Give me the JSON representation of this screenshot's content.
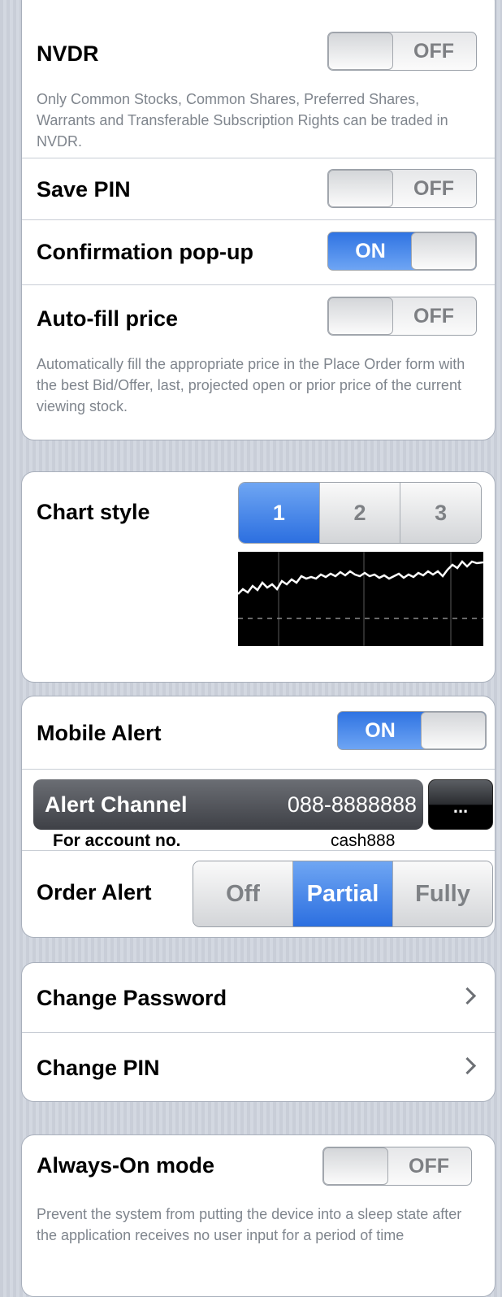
{
  "nvdr": {
    "title": "NVDR",
    "switch": "OFF",
    "description": "Only Common Stocks, Common Shares, Preferred Shares, Warrants and Transferable Subscription Rights can be traded in NVDR."
  },
  "save_pin": {
    "title": "Save PIN",
    "switch": "OFF"
  },
  "confirmation_popup": {
    "title": "Confirmation pop-up",
    "switch": "ON"
  },
  "auto_fill": {
    "title": "Auto-fill price",
    "switch": "OFF",
    "description": "Automatically fill the appropriate price in the Place Order form with the best Bid/Offer, last, projected open or prior price of the current viewing stock."
  },
  "chart_style": {
    "title": "Chart style",
    "options": [
      "1",
      "2",
      "3"
    ],
    "selected": "1"
  },
  "mobile_alert": {
    "title": "Mobile Alert",
    "switch": "ON"
  },
  "alert_channel": {
    "label": "Alert Channel",
    "value": "088-8888888",
    "more_button": "...",
    "account_label": "For account no.",
    "account_value": "cash888"
  },
  "order_alert": {
    "title": "Order Alert",
    "options": [
      "Off",
      "Partial",
      "Fully"
    ],
    "selected": "Partial"
  },
  "change_password": {
    "title": "Change Password"
  },
  "change_pin": {
    "title": "Change PIN"
  },
  "always_on": {
    "title": "Always-On mode",
    "switch": "OFF",
    "description": "Prevent the system from putting the device into a sleep state after the application receives no user input for a period of time"
  },
  "colors": {
    "accent": "#2f73e2",
    "desc_text": "#7f858d"
  },
  "icons": {
    "row_chevron": "chevron-right-icon"
  }
}
